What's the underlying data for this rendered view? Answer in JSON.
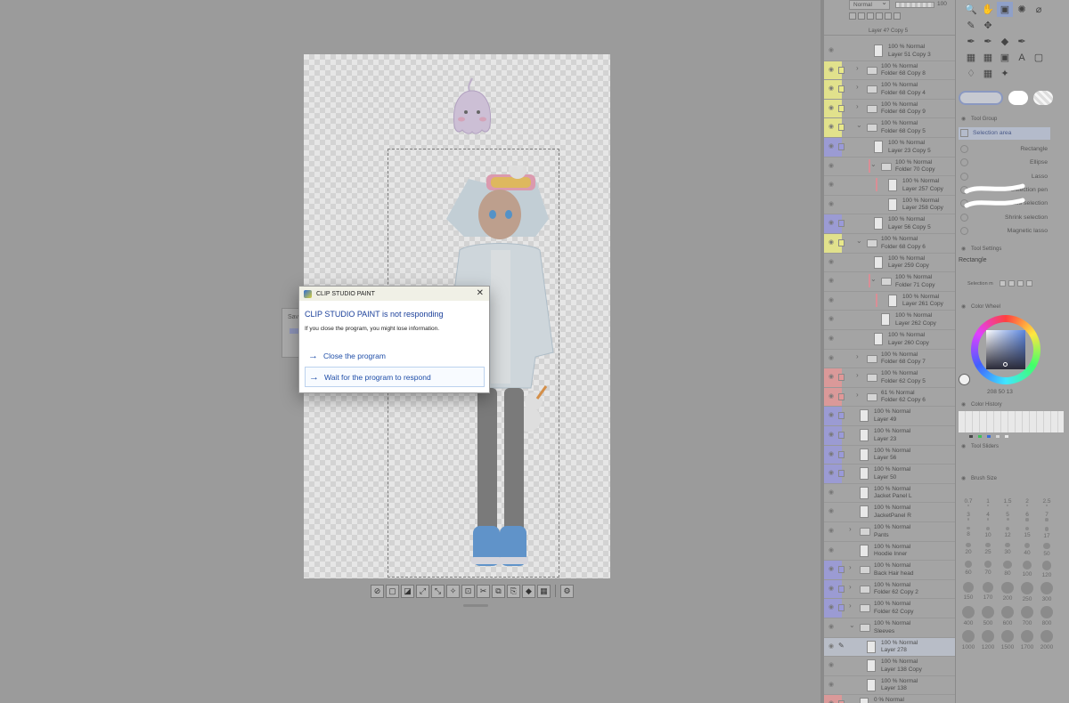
{
  "dialog": {
    "title": "CLIP STUDIO PAINT",
    "heading": "CLIP STUDIO PAINT is not responding",
    "message": "If you close the program, you might lose information.",
    "options": {
      "close": "Close the program",
      "wait": "Wait for the program to respond"
    },
    "close_glyph": "✕"
  },
  "background_dialog_partial": "Sav",
  "layer_panel": {
    "blend_mode": "Normal",
    "opacity": "100",
    "partial_top": "Layer 4? Copy 5",
    "layers": [
      {
        "mode": "100 % Normal",
        "name": "Layer 51 Copy 3",
        "type": "layer",
        "indent": 2,
        "color": ""
      },
      {
        "mode": "100 % Normal",
        "name": "Folder 68 Copy 8",
        "type": "folder",
        "indent": 1,
        "color": "#e8e88a",
        "arrow": "›"
      },
      {
        "mode": "100 % Normal",
        "name": "Folder 68 Copy 4",
        "type": "folder",
        "indent": 1,
        "color": "#e8e88a",
        "arrow": "›"
      },
      {
        "mode": "100 % Normal",
        "name": "Folder 68 Copy 9",
        "type": "folder",
        "indent": 1,
        "color": "#e8e88a",
        "arrow": "›"
      },
      {
        "mode": "100 % Normal",
        "name": "Folder 68 Copy 5",
        "type": "folder",
        "indent": 1,
        "color": "#e8e88a",
        "arrow": "⌄"
      },
      {
        "mode": "100 % Normal",
        "name": "Layer 23 Copy 5",
        "type": "layer",
        "indent": 2,
        "color": "#9a9ad8"
      },
      {
        "mode": "100 % Normal",
        "name": "Folder 70 Copy",
        "type": "folder",
        "indent": 3,
        "color": "",
        "arrow": "⌄",
        "bar": true
      },
      {
        "mode": "100 % Normal",
        "name": "Layer 257 Copy",
        "type": "layer",
        "indent": 4,
        "color": "",
        "bar": true
      },
      {
        "mode": "100 % Normal",
        "name": "Layer 258 Copy",
        "type": "layer",
        "indent": 4,
        "color": ""
      },
      {
        "mode": "100 % Normal",
        "name": "Layer 56 Copy 5",
        "type": "layer",
        "indent": 2,
        "color": "#9a9ad8"
      },
      {
        "mode": "100 % Normal",
        "name": "Folder 68 Copy 6",
        "type": "folder",
        "indent": 1,
        "color": "#e8e88a",
        "arrow": "⌄"
      },
      {
        "mode": "100 % Normal",
        "name": "Layer 259 Copy",
        "type": "layer",
        "indent": 2,
        "color": ""
      },
      {
        "mode": "100 % Normal",
        "name": "Folder 71 Copy",
        "type": "folder",
        "indent": 3,
        "color": "",
        "arrow": "⌄",
        "bar": true
      },
      {
        "mode": "100 % Normal",
        "name": "Layer 261 Copy",
        "type": "layer",
        "indent": 4,
        "color": "",
        "bar": true
      },
      {
        "mode": "100 % Normal",
        "name": "Layer 262 Copy",
        "type": "layer",
        "indent": 3,
        "color": ""
      },
      {
        "mode": "100 % Normal",
        "name": "Layer 260 Copy",
        "type": "layer",
        "indent": 2,
        "color": ""
      },
      {
        "mode": "100 % Normal",
        "name": "Folder 68 Copy 7",
        "type": "folder",
        "indent": 1,
        "color": "",
        "arrow": "›"
      },
      {
        "mode": "100 % Normal",
        "name": "Folder 62 Copy 5",
        "type": "folder",
        "indent": 1,
        "color": "#e09898",
        "arrow": "›"
      },
      {
        "mode": "61 % Normal",
        "name": "Folder 62 Copy 6",
        "type": "folder",
        "indent": 1,
        "color": "#e09898",
        "arrow": "›"
      },
      {
        "mode": "100 % Normal",
        "name": "Layer 49",
        "type": "layer",
        "indent": 0,
        "color": "#9a9ad8"
      },
      {
        "mode": "100 % Normal",
        "name": "Layer 23",
        "type": "layer",
        "indent": 0,
        "color": "#9a9ad8"
      },
      {
        "mode": "100 % Normal",
        "name": "Layer 56",
        "type": "layer",
        "indent": 0,
        "color": "#9a9ad8"
      },
      {
        "mode": "100 % Normal",
        "name": "Layer 50",
        "type": "layer",
        "indent": 0,
        "color": "#9a9ad8"
      },
      {
        "mode": "100 % Normal",
        "name": "Jacket Panel L",
        "type": "layer",
        "indent": 0,
        "color": ""
      },
      {
        "mode": "100 % Normal",
        "name": "JacketPanel R",
        "type": "layer",
        "indent": 0,
        "color": ""
      },
      {
        "mode": "100 % Normal",
        "name": "Pants",
        "type": "folder",
        "indent": 0,
        "color": "",
        "arrow": "›"
      },
      {
        "mode": "100 % Normal",
        "name": "Hoodie Inner",
        "type": "layer",
        "indent": 0,
        "color": ""
      },
      {
        "mode": "100 % Normal",
        "name": "Back Hair head",
        "type": "folder",
        "indent": 0,
        "color": "#9a9ad8",
        "arrow": "›"
      },
      {
        "mode": "100 % Normal",
        "name": "Folder 62 Copy 2",
        "type": "folder",
        "indent": 0,
        "color": "#9a9ad8",
        "arrow": "›"
      },
      {
        "mode": "100 % Normal",
        "name": "Folder 62 Copy",
        "type": "folder",
        "indent": 0,
        "color": "#9a9ad8",
        "arrow": "›"
      },
      {
        "mode": "100 % Normal",
        "name": "Sleeves",
        "type": "folder",
        "indent": 0,
        "color": "",
        "arrow": "⌄"
      },
      {
        "mode": "100 % Normal",
        "name": "Layer 278",
        "type": "layer",
        "indent": 1,
        "color": "",
        "selected": true
      },
      {
        "mode": "100 % Normal",
        "name": "Layer 138 Copy",
        "type": "layer",
        "indent": 1,
        "color": ""
      },
      {
        "mode": "100 % Normal",
        "name": "Layer 138",
        "type": "layer",
        "indent": 1,
        "color": ""
      },
      {
        "mode": "0 % Normal",
        "name": "",
        "type": "layer",
        "indent": 0,
        "color": "#e09898"
      }
    ]
  },
  "tool_palette": {
    "icons": [
      "🔍",
      "✋",
      "▣",
      "✺",
      "⌀",
      "✎",
      "✥",
      "",
      "",
      "",
      "✒",
      "✒",
      "◆",
      "✒",
      "",
      "▦",
      "▦",
      "▣",
      "A",
      "▢",
      "♢",
      "▦",
      "✦",
      "",
      ""
    ]
  },
  "sub_tool": {
    "header": "Tool Group",
    "group_label": "Selection area",
    "items": [
      "Rectangle",
      "Ellipse",
      "Lasso",
      "Selection pen",
      "Erase selection",
      "Shrink selection",
      "Magnetic lasso"
    ]
  },
  "tool_settings": {
    "header": "Tool Settings",
    "tool_name": "Rectangle",
    "selection_mode_label": "Selection m"
  },
  "color_wheel": {
    "header": "Color Wheel",
    "h": "208",
    "s": "50",
    "v": "13",
    "hsv_text": "208  50  13"
  },
  "color_history": {
    "header": "Color History"
  },
  "tool_sliders": {
    "header": "Tool Sliders"
  },
  "brush_size": {
    "header": "Brush Size",
    "sizes": [
      "0.7",
      "1",
      "1.5",
      "2",
      "2.5",
      "3",
      "4",
      "5",
      "6",
      "7",
      "8",
      "10",
      "12",
      "15",
      "17",
      "20",
      "25",
      "30",
      "40",
      "50",
      "60",
      "70",
      "80",
      "100",
      "120",
      "150",
      "170",
      "200",
      "250",
      "300",
      "400",
      "500",
      "600",
      "700",
      "800",
      "1000",
      "1200",
      "1500",
      "1700",
      "2000"
    ]
  },
  "colors": {
    "background": "#9b9b9b",
    "dialog_link": "#1f4ea8",
    "dialog_heading": "#1a3f9a",
    "label_yellow": "#e8e88a",
    "label_blue": "#9a9ad8",
    "label_red": "#e09898"
  }
}
